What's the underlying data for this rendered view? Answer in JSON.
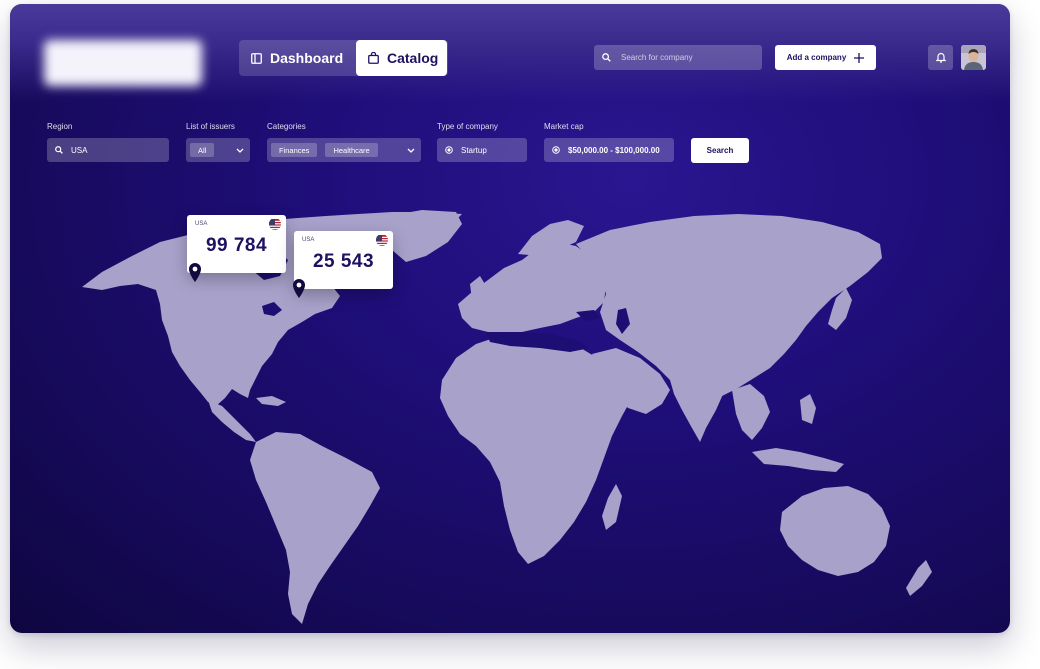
{
  "header": {
    "tabs": [
      {
        "label": "Dashboard",
        "icon": "dashboard-icon",
        "active": false
      },
      {
        "label": "Catalog",
        "icon": "shopping-bag-icon",
        "active": true
      }
    ],
    "search_placeholder": "Search for company",
    "add_company_label": "Add a company",
    "bell_icon": "bell-icon",
    "avatar": "user-avatar"
  },
  "filters": {
    "region": {
      "label": "Region",
      "value": "USA",
      "icon": "search-icon"
    },
    "issuers": {
      "label": "List of issuers",
      "value": "All",
      "icon": "chevron-down-icon"
    },
    "categories": {
      "label": "Categories",
      "chips": [
        "Finances",
        "Healthcare"
      ],
      "icon": "chevron-down-icon"
    },
    "company_type": {
      "label": "Type of company",
      "value": "Startup",
      "icon": "radio-dot-icon"
    },
    "market_cap": {
      "label": "Market cap",
      "value": "$50,000.00 - $100,000.00",
      "icon": "radio-dot-icon"
    },
    "search_button": "Search"
  },
  "map": {
    "callouts": [
      {
        "country": "USA",
        "value": "99 784",
        "flag": "us-flag-icon"
      },
      {
        "country": "USA",
        "value": "25 543",
        "flag": "us-flag-icon"
      }
    ]
  },
  "colors": {
    "background": "#1f0e7a",
    "land": "#a8a2cb",
    "accent_text": "#1d1260",
    "card": "#ffffff"
  }
}
